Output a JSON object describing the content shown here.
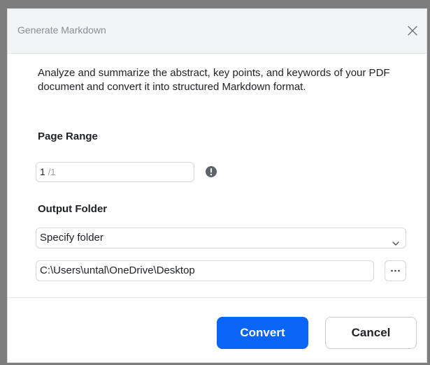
{
  "dialog": {
    "title": "Generate Markdown",
    "close_icon": "close-icon",
    "description": "Analyze and summarize the abstract, key points, and keywords of your PDF document and convert it into structured Markdown format."
  },
  "page_range": {
    "label": "Page Range",
    "value": "1",
    "total": "/1",
    "info_icon": "exclamation-circle-icon"
  },
  "output_folder": {
    "label": "Output Folder",
    "selected_option": "Specify folder",
    "path": "C:\\Users\\untal\\OneDrive\\Desktop",
    "browse_label": "···"
  },
  "actions": {
    "convert_label": "Convert",
    "cancel_label": "Cancel"
  },
  "colors": {
    "primary": "#0a64f5",
    "titlebar_bg": "#f3f4f6",
    "info_icon": "#5f636b"
  }
}
